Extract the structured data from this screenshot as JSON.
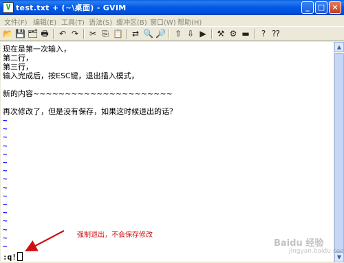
{
  "window": {
    "title": "test.txt + (~\\桌面) - GVIM",
    "app_icon": "vim-icon"
  },
  "menu": [
    "文件(F)",
    "编辑(E)",
    "工具(T)",
    "语法(S)",
    "缓冲区(B)",
    "窗口(W)",
    "帮助(H)"
  ],
  "toolbar_icons": [
    "open-icon",
    "save-icon",
    "save-all-icon",
    "print-icon",
    "undo-icon",
    "redo-icon",
    "cut-icon",
    "copy-icon",
    "paste-icon",
    "replace-icon",
    "find-next-icon",
    "find-prev-icon",
    "load-session-icon",
    "save-session-icon",
    "run-script-icon",
    "make-icon",
    "build-tags-icon",
    "jump-tag-icon",
    "help-icon",
    "find-help-icon"
  ],
  "editor": {
    "lines": [
      "现在是第一次输入，",
      "第二行，",
      "第三行，",
      "输入完成后，按ESC键，退出插入模式，",
      "",
      "新的内容~~~~~~~~~~~~~~~~~~~~~~",
      "",
      "再次修改了，但是没有保存，如果这时候退出的话？"
    ],
    "tilde": "~",
    "command": ":q!"
  },
  "annotation": "强制退出，不会保存修改",
  "watermark": {
    "main": "Baidu 经验",
    "sub": "jingyan.baidu.com"
  },
  "colors": {
    "titlebar": "#0058e6",
    "tilde": "#0000ff",
    "annotation": "#d01010"
  }
}
